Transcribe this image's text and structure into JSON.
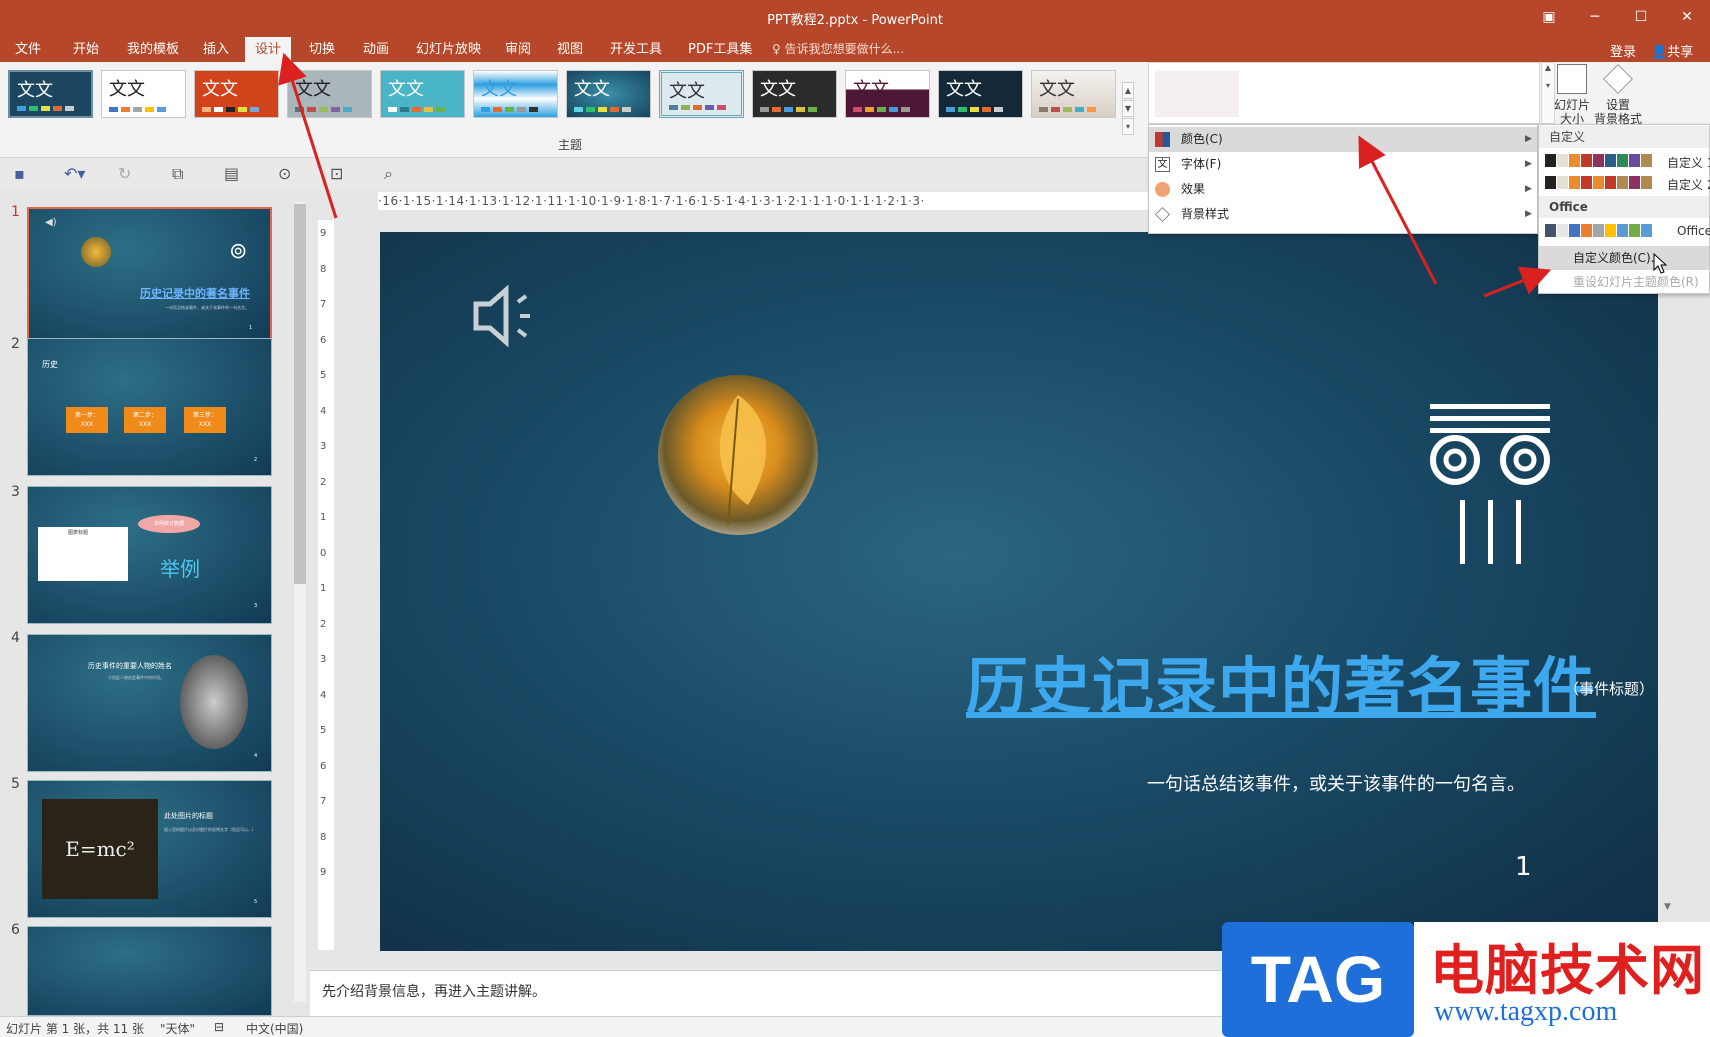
{
  "window": {
    "title": "PPT教程2.pptx - PowerPoint"
  },
  "menu": {
    "tabs": [
      "文件",
      "开始",
      "我的模板",
      "插入",
      "设计",
      "切换",
      "动画",
      "幻灯片放映",
      "审阅",
      "视图",
      "开发工具",
      "PDF工具集"
    ],
    "tell_me": "告诉我您想要做什么...",
    "login": "登录",
    "share": "共享"
  },
  "ribbon": {
    "group_label": "主题",
    "theme_tile_text": "文文",
    "slide_size": "幻灯片\n大小",
    "format_bg": "设置\n背景格式"
  },
  "ruler": {
    "h": "·16·1·15·1·14·1·13·1·12·1·11·1·10·1·9·1·8·1·7·1·6·1·5·1·4·1·3·1·2·1·1·1·0·1·1·1·2·1·3·",
    "v": [
      "9",
      "8",
      "7",
      "6",
      "5",
      "4",
      "3",
      "2",
      "1",
      "0",
      "1",
      "2",
      "3",
      "4",
      "5",
      "6",
      "7",
      "8",
      "9"
    ]
  },
  "slides": {
    "numbers": [
      "1",
      "2",
      "3",
      "4",
      "5",
      "6"
    ],
    "s2": {
      "title": "历史",
      "steps": [
        "第一步：\nXXX",
        "第二步：\nXXX",
        "第三步：\nXXX"
      ],
      "num": "2"
    },
    "s3": {
      "chart_title": "图表标题",
      "bubble": "举例统计数据",
      "big": "举例",
      "num": "3"
    },
    "s4": {
      "title": "历史事件的重要人物的姓名",
      "sub": "介绍此人物在此事件中的作用。",
      "num": "4"
    },
    "s5": {
      "formula": "E=mc²",
      "title": "此处图片的标题",
      "body": "插入您的图片以及对图片的说明文字（您还可以...）",
      "num": "5"
    },
    "s1": {
      "title": "历史记录中的著名事件",
      "sub": "一句话总结该事件，或关于该事件的一句名言。",
      "num": "1"
    }
  },
  "main_slide": {
    "headline": "历史记录中的著名事件",
    "headline_note": "（事件标题）",
    "subline": "一句话总结该事件，或关于该事件的一句名言。",
    "number": "1"
  },
  "notes": "先介绍背景信息，再进入主题讲解。",
  "status": {
    "slide": "幻灯片 第 1 张，共 11 张",
    "theme": "\"天体\"",
    "lang": "中文(中国)"
  },
  "dropdown": {
    "items": [
      "颜色(C)",
      "字体(F)",
      "效果",
      "背景样式"
    ]
  },
  "submenu": {
    "custom_head": "自定义",
    "custom1": "自定义 1",
    "custom2": "自定义 2",
    "office_head": "Office",
    "office": "Office",
    "customize": "自定义颜色(C)...",
    "reset": "重设幻灯片主题颜色(R)"
  },
  "watermark": {
    "tag": "TAG",
    "cn": "电脑技术网",
    "url": "www.tagxp.com"
  },
  "colors": {
    "title_bar": "#b7472a",
    "slide_bg": "#1a4a66",
    "headline": "#3ea8ee",
    "arrow": "#d9211f"
  }
}
